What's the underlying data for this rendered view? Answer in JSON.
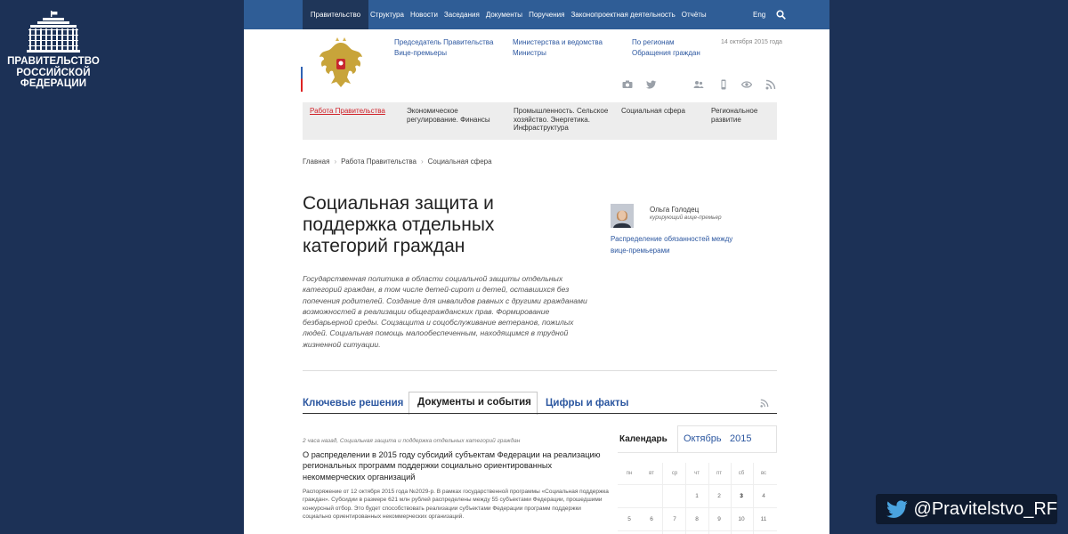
{
  "logo": {
    "text": "ПРАВИТЕЛЬСТВО\nРОССИЙСКОЙ\nФЕДЕРАЦИИ",
    "icon": "government-building-icon"
  },
  "twitter_badge": {
    "handle": "@Pravitelstvo_RF",
    "icon": "twitter-bird-icon"
  },
  "topnav": {
    "home": "Правительство России",
    "items": [
      "Структура",
      "Новости",
      "Заседания",
      "Документы",
      "Поручения",
      "Законопроектная деятельность",
      "Отчёты"
    ],
    "lang": "Eng",
    "search_icon": "search-icon"
  },
  "header": {
    "links_col1": [
      "Председатель Правительства",
      "Вице-премьеры"
    ],
    "links_col2": [
      "Министерства и ведомства",
      "Министры"
    ],
    "links_col3": [
      "По регионам",
      "Обращения граждан"
    ],
    "date": "14 октября 2015 года",
    "social_icons": [
      "camera-icon",
      "twitter-icon",
      "people-icon",
      "mobile-icon",
      "eye-icon",
      "rss-icon"
    ]
  },
  "categories": [
    "Работа Правительства",
    "Экономическое\nрегулирование. Финансы",
    "Промышленность. Сельское\nхозяйство. Энергетика.\nИнфраструктура",
    "Социальная сфера",
    "Региональное\nразвитие"
  ],
  "breadcrumbs": [
    "Главная",
    "Работа Правительства",
    "Социальная сфера"
  ],
  "page_title": "Социальная защита и\nподдержка отдельных\nкатегорий граждан",
  "description": "Государственная политика в области социальной защиты отдельных категорий граждан, в том числе детей-сирот и детей, оставшихся без попечения родителей. Создание для инвалидов равных с другими гражданами возможностей в реализации общегражданских прав. Формирование безбарьерной среды. Соцзащита и соцобслуживание ветеранов, пожилых людей. Социальная помощь малообеспеченным, находящимся в трудной жизненной ситуации.",
  "person": {
    "name": "Ольга Голодец",
    "role": "курирующий вице-премьер",
    "link": "Распределение обязанностей между вице-премьерами"
  },
  "tabs": [
    "Ключевые решения",
    "Документы и события",
    "Цифры и факты"
  ],
  "news": {
    "meta": "2 часа назад, Социальная защита и поддержка отдельных категорий граждан",
    "title": "О распределении в 2015 году субсидий субъектам Федерации на реализацию региональных программ поддержки социально ориентированных некоммерческих организаций",
    "body": "Распоряжение от 12 октября 2015 года №2029-р. В рамках государственной программы «Социальная поддержка граждан». Субсидии в размере 621 млн рублей распределены между 55 субъектами Федерации, прошедшими конкурсный отбор. Это будет способствовать реализации субъектами Федерации программ поддержки социально ориентированных некоммерческих организаций."
  },
  "calendar": {
    "title": "Календарь",
    "month": "Октябрь",
    "year": "2015",
    "weekdays": [
      "пн",
      "вт",
      "ср",
      "чт",
      "пт",
      "сб",
      "вс"
    ],
    "row1": [
      "1",
      "2",
      "3",
      "4"
    ],
    "row2": [
      "5",
      "6",
      "7",
      "8",
      "9",
      "10",
      "11"
    ]
  },
  "colors": {
    "navy": "#1c3156",
    "nav_blue": "#2f5d96",
    "link": "#2c57a0",
    "accent_red": "#d0222a"
  }
}
